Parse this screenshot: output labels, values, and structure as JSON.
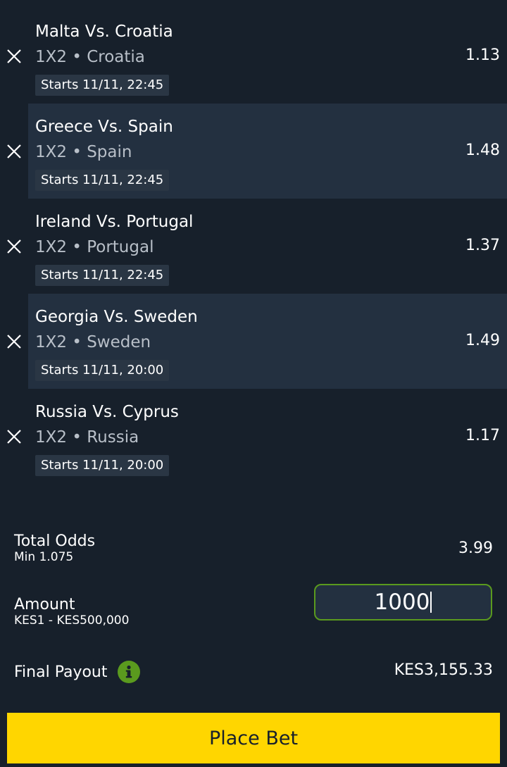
{
  "selections": [
    {
      "match": "Malta Vs. Croatia",
      "market": "1X2 • Croatia",
      "starts": "Starts 11/11, 22:45",
      "odds": "1.13"
    },
    {
      "match": "Greece Vs. Spain",
      "market": "1X2 • Spain",
      "starts": "Starts 11/11, 22:45",
      "odds": "1.48"
    },
    {
      "match": "Ireland Vs. Portugal",
      "market": "1X2 • Portugal",
      "starts": "Starts 11/11, 22:45",
      "odds": "1.37"
    },
    {
      "match": "Georgia Vs. Sweden",
      "market": "1X2 • Sweden",
      "starts": "Starts 11/11, 20:00",
      "odds": "1.49"
    },
    {
      "match": "Russia Vs. Cyprus",
      "market": "1X2 • Russia",
      "starts": "Starts 11/11, 20:00",
      "odds": "1.17"
    }
  ],
  "summary": {
    "total_odds_label": "Total Odds",
    "min_odds": "Min 1.075",
    "total_odds_value": "3.99",
    "amount_label": "Amount",
    "amount_range": "KES1 - KES500,000",
    "amount_value": "1000",
    "final_payout_label": "Final Payout",
    "final_payout_value": "KES3,155.33"
  },
  "actions": {
    "place_bet_label": "Place Bet"
  },
  "colors": {
    "background": "#17202b",
    "alt_row": "#233040",
    "accent_green": "#5a9a1e",
    "primary_button": "#ffd600"
  },
  "icons": {
    "remove": "close-icon",
    "info": "info-icon"
  }
}
